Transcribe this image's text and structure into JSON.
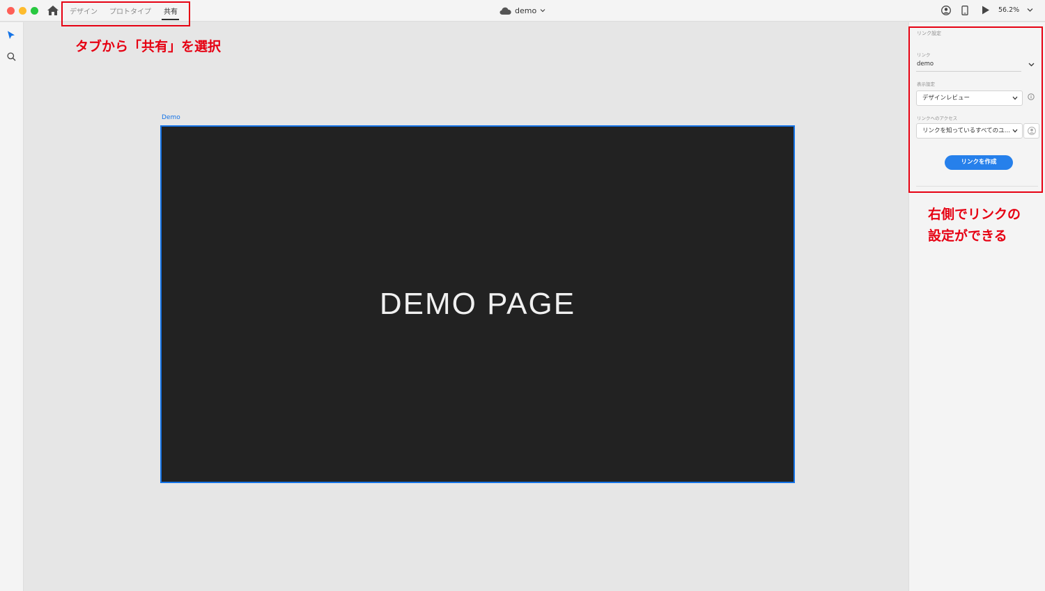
{
  "app": {
    "tabs": [
      {
        "label": "デザイン",
        "active": false
      },
      {
        "label": "プロトタイプ",
        "active": false
      },
      {
        "label": "共有",
        "active": true
      }
    ],
    "document_title": "demo",
    "zoom": "56.2%",
    "icons": {
      "home": "home-icon",
      "cloud": "cloud-icon",
      "user": "user-icon",
      "device": "mobile-device-icon",
      "play": "play-icon",
      "select_tool": "arrow-select-icon",
      "zoom_tool": "magnifier-icon"
    }
  },
  "canvas": {
    "artboard_label": "Demo",
    "artboard_text": "DEMO PAGE"
  },
  "share_panel": {
    "section_title": "リンク設定",
    "link_label": "リンク",
    "link_value": "demo",
    "display_label": "表示設定",
    "display_value": "デザインレビュー",
    "access_label": "リンクへのアクセス",
    "access_value": "リンクを知っているすべてのユ…",
    "create_button": "リンクを作成"
  },
  "annotations": {
    "tabs_note": "タブから「共有」を選択",
    "panel_note_line1": "右側でリンクの",
    "panel_note_line2": "設定ができる"
  },
  "colors": {
    "accent_blue": "#2680eb",
    "selection_blue": "#1473e6",
    "annotation_red": "#e60012",
    "artboard_bg": "#222222"
  }
}
